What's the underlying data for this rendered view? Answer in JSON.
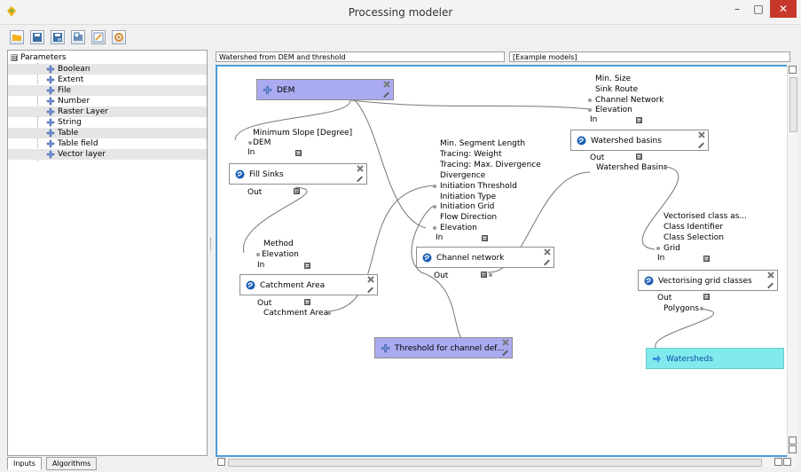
{
  "window": {
    "title": "Processing modeler",
    "controls": {
      "minimize": "–",
      "maximize": "□",
      "close": "✕"
    }
  },
  "toolbar": {
    "buttons": [
      {
        "name": "open-model-button",
        "icon": "folder-icon",
        "color": "#f2b21c"
      },
      {
        "name": "save-button",
        "icon": "save-icon",
        "color": "#3a6ea5"
      },
      {
        "name": "save-as-button",
        "icon": "save-as-icon",
        "color": "#3a6ea5"
      },
      {
        "name": "export-image-button",
        "icon": "export-image-icon",
        "color": "#3a6ea5"
      },
      {
        "name": "edit-help-button",
        "icon": "edit-help-icon",
        "color": "#e2a23b"
      },
      {
        "name": "run-button",
        "icon": "run-icon",
        "color": "#d68a2c"
      }
    ]
  },
  "inputs_panel": {
    "root": {
      "expander": "⊟",
      "label": "Parameters"
    },
    "items": [
      {
        "label": "Boolean"
      },
      {
        "label": "Extent"
      },
      {
        "label": "File"
      },
      {
        "label": "Number"
      },
      {
        "label": "Raster Layer"
      },
      {
        "label": "String"
      },
      {
        "label": "Table"
      },
      {
        "label": "Table field"
      },
      {
        "label": "Vector layer"
      }
    ]
  },
  "tabs": {
    "inputs": "Inputs",
    "algorithms": "Algorithms"
  },
  "model": {
    "name": "Watershed from DEM and threshold",
    "group": "[Example models]"
  },
  "canvas": {
    "nodes": {
      "dem": "DEM",
      "fill_sinks": "Fill Sinks",
      "catchment_area": "Catchment Area",
      "threshold": "Threshold for channel def...",
      "channel_network": "Channel network",
      "watershed_basins": "Watershed basins",
      "vectorising": "Vectorising grid classes",
      "watersheds": "Watersheds"
    },
    "fill_sinks_inputs": [
      "Minimum Slope [Degree]",
      "DEM",
      "In"
    ],
    "fill_sinks_out": "Out",
    "catchment_inputs": [
      "Method",
      "Elevation",
      "In"
    ],
    "catchment_outputs": [
      "Out",
      "Catchment Area"
    ],
    "channel_inputs": [
      "Min. Segment Length",
      "Tracing: Weight",
      "Tracing: Max. Divergence",
      "Divergence",
      "Initiation Threshold",
      "Initiation Type",
      "Initiation Grid",
      "Flow Direction",
      "Elevation",
      "In"
    ],
    "channel_out": "Out",
    "basins_inputs": [
      "Min. Size",
      "Sink Route",
      "Channel Network",
      "Elevation",
      "In"
    ],
    "basins_outputs": [
      "Out",
      "Watershed Basins"
    ],
    "vector_inputs": [
      "Vectorised class as...",
      "Class Identifier",
      "Class Selection",
      "Grid",
      "In"
    ],
    "vector_outputs": [
      "Out",
      "Polygons"
    ],
    "collapse_symbol": "⊟",
    "expand_symbol": "⊞"
  },
  "colors": {
    "input_node": "#aaaaf0",
    "output_node": "#80eaec",
    "canvas_border": "#4b9bd6",
    "close_button": "#c7382a",
    "algorithm_icon": "#1b5fb8"
  }
}
